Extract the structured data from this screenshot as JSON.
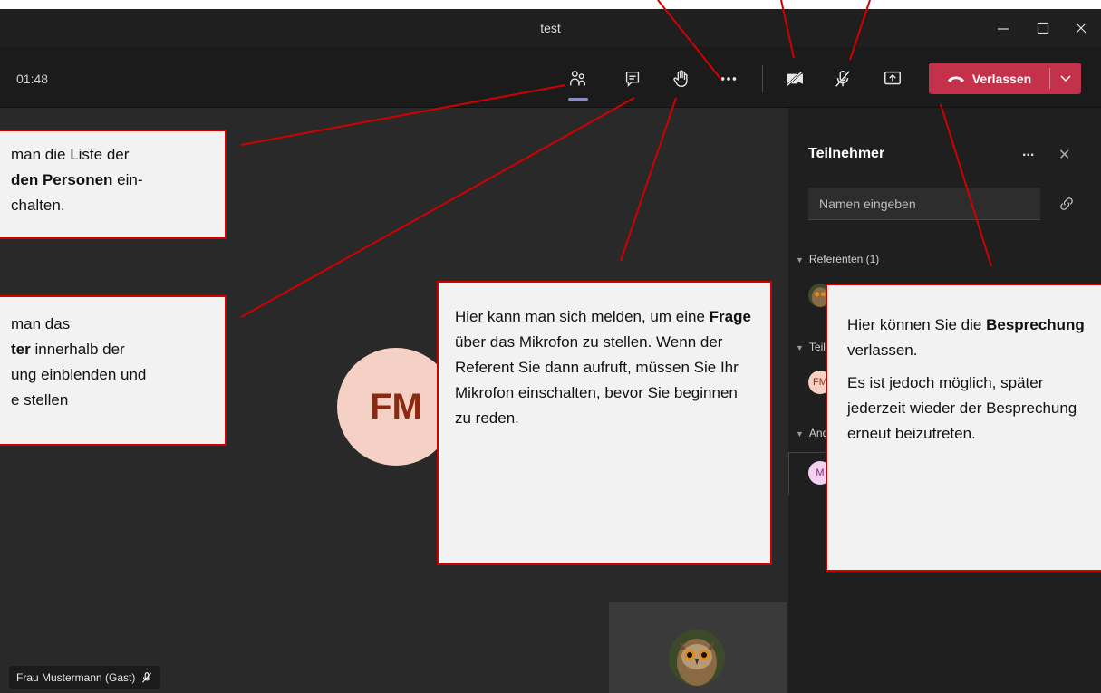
{
  "window": {
    "title": "test"
  },
  "toolbar": {
    "timer": "01:48",
    "leave_label": "Verlassen"
  },
  "stage": {
    "main_avatar_initials": "FM",
    "name_tag": "Frau Mustermann (Gast)"
  },
  "panel": {
    "title": "Teilnehmer",
    "more": "...",
    "close": "✕",
    "search_placeholder": "Namen eingeben",
    "section1": "Referenten (1)",
    "section2_partial": "Teil",
    "section3_partial": "And",
    "participant_fm_initials": "FM",
    "participant_m_initials": "M"
  },
  "callouts": {
    "left1": {
      "line1": "man die Liste der",
      "line2_bold": "den Personen",
      "line2_rest": " ein-",
      "line3": "chalten."
    },
    "left2": {
      "line1": "man das",
      "line2_bold": "ter",
      "line2_rest": " innerhalb der",
      "line3": "ung einblenden und",
      "line4": "e stellen"
    },
    "center": {
      "t1": "Hier kann man sich melden, um eine ",
      "bold": "Frage",
      "t2": " über das Mikrofon zu stellen. Wenn der Referent Sie dann aufruft, müssen Sie Ihr Mikrofon einschalten, bevor Sie beginnen zu reden."
    },
    "right": {
      "t1": "Hier können Sie die ",
      "bold": "Besprechung",
      "t2": " verlassen.",
      "p2": "Es ist jedoch möglich, später jederzeit wieder der Besprechung erneut beizutreten."
    }
  },
  "colors": {
    "accent": "#c4314b",
    "callout_border": "#d10000",
    "active_tab": "#8b8cc7"
  }
}
